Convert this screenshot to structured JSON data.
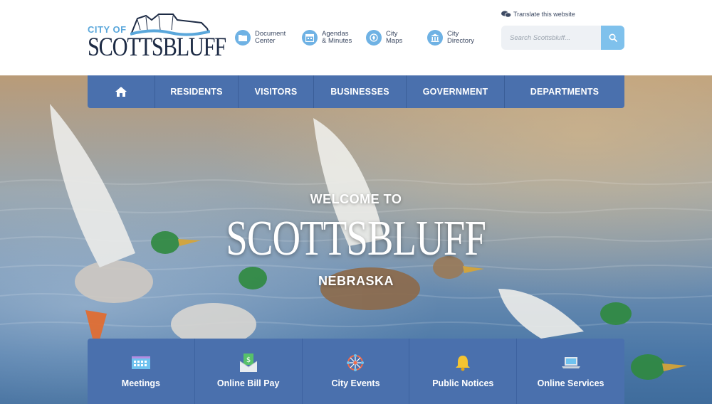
{
  "header": {
    "logo": {
      "prefix": "CITY OF",
      "name": "SCOTTSBLUFF"
    },
    "quick_links": [
      {
        "label": "Document\nCenter",
        "icon": "folder-icon"
      },
      {
        "label": "Agendas\n& Minutes",
        "icon": "calendar-icon"
      },
      {
        "label": "City\nMaps",
        "icon": "map-pin-icon"
      },
      {
        "label": "City\nDirectory",
        "icon": "government-building-icon"
      }
    ],
    "translate": {
      "label": "Translate this website",
      "icon": "chat-bubbles-icon"
    },
    "search": {
      "placeholder": "Search Scottsbluff...",
      "value": "",
      "icon": "search-icon"
    }
  },
  "nav": {
    "home_icon": "home-icon",
    "items": [
      "RESIDENTS",
      "VISITORS",
      "BUSINESSES",
      "GOVERNMENT",
      "DEPARTMENTS"
    ]
  },
  "hero": {
    "welcome": "WELCOME TO",
    "title": "SCOTTSBLUFF",
    "subtitle": "NEBRASKA"
  },
  "quick_cards": [
    {
      "label": "Meetings",
      "icon": "meeting-building-icon"
    },
    {
      "label": "Online Bill Pay",
      "icon": "money-envelope-icon"
    },
    {
      "label": "City Events",
      "icon": "ferris-wheel-icon"
    },
    {
      "label": "Public Notices",
      "icon": "bell-icon"
    },
    {
      "label": "Online Services",
      "icon": "laptop-icon"
    }
  ],
  "colors": {
    "brand_blue": "#4a70ad",
    "accent_light_blue": "#6fb2e4",
    "logo_dark": "#1c2a44"
  }
}
